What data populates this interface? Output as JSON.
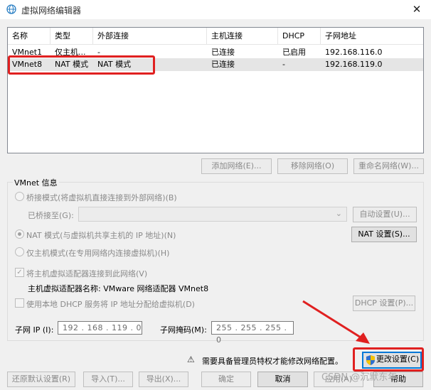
{
  "window": {
    "title": "虚拟网络编辑器",
    "close_symbol": "✕"
  },
  "network_list": {
    "columns": [
      "名称",
      "类型",
      "外部连接",
      "主机连接",
      "DHCP",
      "子网地址"
    ],
    "rows": [
      {
        "name": "VMnet1",
        "type": "仅主机...",
        "external": "-",
        "host": "已连接",
        "dhcp": "已启用",
        "subnet": "192.168.116.0"
      },
      {
        "name": "VMnet8",
        "type": "NAT 模式",
        "external": "NAT 模式",
        "host": "已连接",
        "dhcp": "-",
        "subnet": "192.168.119.0"
      }
    ]
  },
  "list_buttons": {
    "add": "添加网络(E)...",
    "remove": "移除网络(O)",
    "rename": "重命名网络(W)..."
  },
  "vmnet_info": {
    "legend": "VMnet 信息",
    "bridge_label": "桥接模式(将虚拟机直接连接到外部网络)(B)",
    "bridged_to_label": "已桥接至(G):",
    "auto_settings": "自动设置(U)...",
    "nat_label": "NAT 模式(与虚拟机共享主机的 IP 地址)(N)",
    "nat_settings": "NAT 设置(S)...",
    "hostonly_label": "仅主机模式(在专用网络内连接虚拟机)(H)",
    "connect_adapter_label": "将主机虚拟适配器连接到此网络(V)",
    "check_mark": "✓",
    "adapter_name_label": "主机虚拟适配器名称: VMware 网络适配器 VMnet8",
    "dhcp_label": "使用本地 DHCP 服务将 IP 地址分配给虚拟机(D)",
    "dhcp_settings": "DHCP 设置(P)...",
    "subnet_ip_label": "子网 IP (I):",
    "subnet_ip_value": "192 . 168 . 119 .  0",
    "subnet_mask_label": "子网掩码(M):",
    "subnet_mask_value": "255 . 255 . 255 .  0"
  },
  "admin": {
    "warning_icon": "⚠",
    "notice": "需要具备管理员特权才能修改网络配置。",
    "change_settings": "更改设置(C)"
  },
  "footer": {
    "restore_defaults": "还原默认设置(R)",
    "import": "导入(T)...",
    "export": "导出(X)...",
    "ok": "确定",
    "cancel": "取消",
    "apply": "应用(A)",
    "help": "帮助"
  },
  "watermark": "CSDN @沉默东年",
  "colors": {
    "annotation_red": "#e02020",
    "selection": "#e5e5e5",
    "focus_blue": "#0078d7"
  }
}
